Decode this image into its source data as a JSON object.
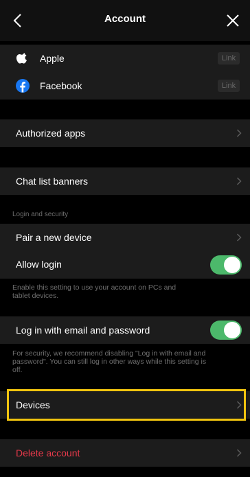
{
  "header": {
    "title": "Account"
  },
  "social": [
    {
      "name": "Apple",
      "icon": "apple-icon",
      "action": "Link"
    },
    {
      "name": "Facebook",
      "icon": "facebook-icon",
      "action": "Link"
    }
  ],
  "menu": {
    "authorized_apps": "Authorized apps",
    "chat_list_banners": "Chat list banners",
    "pair_device": "Pair a new device",
    "allow_login": "Allow login",
    "log_in_email": "Log in with email and password",
    "devices": "Devices",
    "delete_account": "Delete account"
  },
  "sections": {
    "login_security": "Login and security"
  },
  "descriptions": {
    "allow_login_line1": "Enable this setting to use your account on PCs and",
    "allow_login_line2": "tablet devices.",
    "email_line1": "For security, we recommend disabling \"Log in with email and",
    "email_line2": "password\". You can still log in other ways while this setting is",
    "email_line3": "off."
  },
  "toggles": {
    "allow_login": true,
    "log_in_email": true
  },
  "colors": {
    "toggle_on": "#4cb96b",
    "highlight": "#f1c40f",
    "danger": "#e5394a",
    "facebook": "#1877f2"
  }
}
